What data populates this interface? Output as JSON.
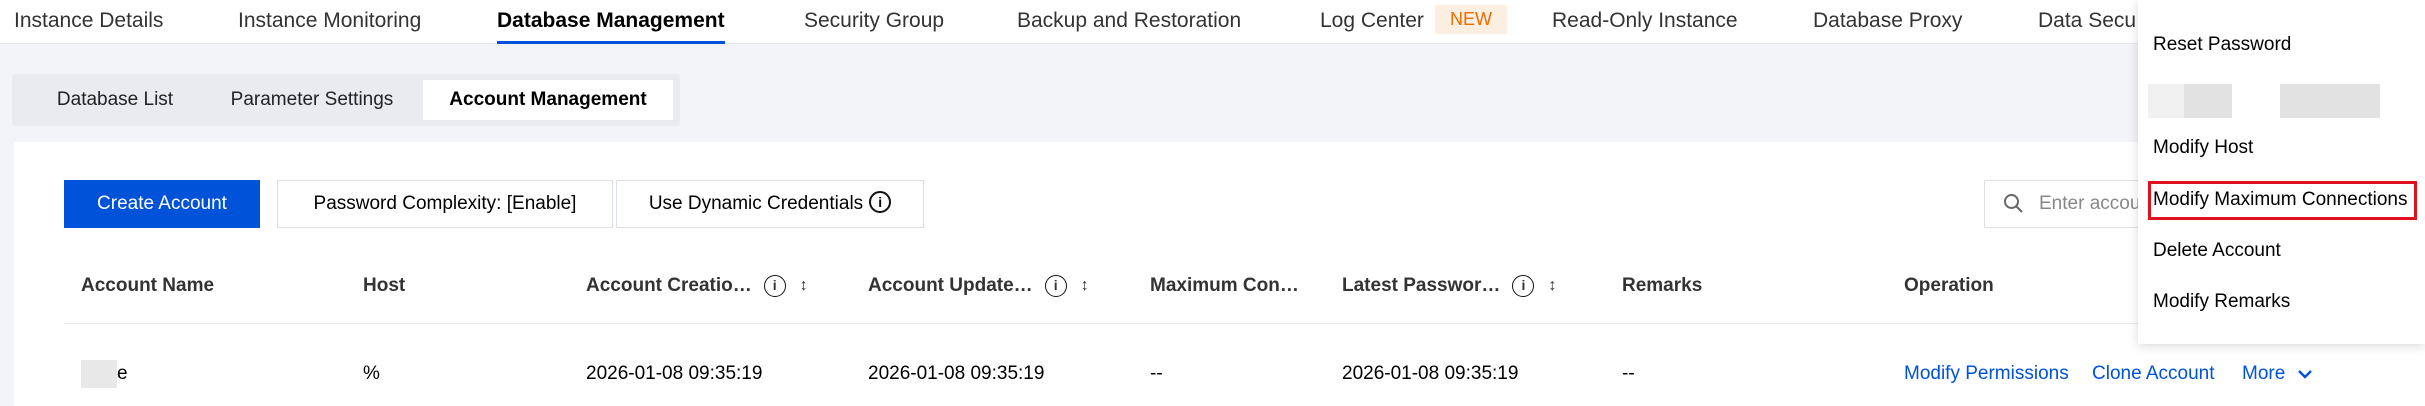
{
  "top_tabs": [
    {
      "label": "Instance Details"
    },
    {
      "label": "Instance Monitoring"
    },
    {
      "label": "Database Management"
    },
    {
      "label": "Security Group"
    },
    {
      "label": "Backup and Restoration"
    },
    {
      "label": "Log Center"
    },
    {
      "label": "Read-Only Instance"
    },
    {
      "label": "Database Proxy"
    },
    {
      "label": "Data Secu"
    }
  ],
  "log_center_badge": "NEW",
  "sub_tabs": [
    {
      "label": "Database List"
    },
    {
      "label": "Parameter Settings"
    },
    {
      "label": "Account Management"
    }
  ],
  "toolbar": {
    "create_account_label": "Create Account",
    "password_complexity_label": "Password Complexity: [Enable]",
    "dynamic_credentials_label": "Use Dynamic Credentials",
    "info_glyph": "i"
  },
  "search": {
    "placeholder": "Enter account"
  },
  "table": {
    "headers": [
      "Account Name",
      "Host",
      "Account Creatio…",
      "Account Update…",
      "Maximum Con…",
      "Latest Passwor…",
      "Remarks",
      "Operation"
    ],
    "sort_glyph": "↕",
    "rows": [
      {
        "account_name_suffix": "e",
        "host": "%",
        "created": "2026-01-08 09:35:19",
        "updated": "2026-01-08 09:35:19",
        "max_connections": "--",
        "latest_password": "2026-01-08 09:35:19",
        "remarks": "--",
        "operations": [
          "Modify Permissions",
          "Clone Account",
          "More"
        ]
      }
    ]
  },
  "more_menu": {
    "items": [
      "Reset Password",
      "Modify Host",
      "Modify Maximum Connections",
      "Delete Account",
      "Modify Remarks"
    ],
    "highlighted_item": "Modify Maximum Connections",
    "highlight_color": "#e0101e"
  },
  "colors": {
    "accent": "#0052d9",
    "badge_bg": "#fdeee2",
    "badge_text": "#ef6c00"
  }
}
